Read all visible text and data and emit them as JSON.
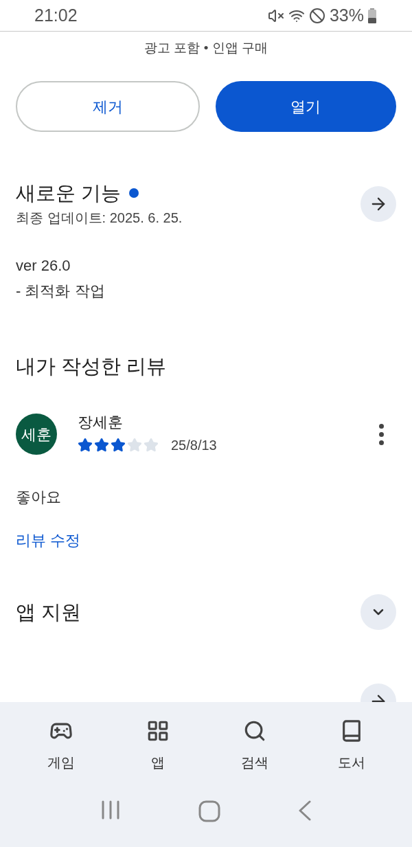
{
  "status_bar": {
    "time": "21:02",
    "battery": "33%"
  },
  "app_meta": "광고 포함 • 인앱 구매",
  "buttons": [
    {
      "label": "제거",
      "kind": "outline"
    },
    {
      "label": "열기",
      "kind": "filled"
    }
  ],
  "whats_new": {
    "title": "새로운 기능",
    "new_dot": true,
    "updated": "최종 업데이트: 2025. 6. 25.",
    "lines": [
      "ver 26.0",
      "- 최적화 작업"
    ]
  },
  "my_review": {
    "title": "내가 작성한 리뷰",
    "avatar": "세훈",
    "author": "장세훈",
    "stars": 3,
    "date": "25/8/13",
    "body": "좋아요",
    "edit_link": "리뷰 수정"
  },
  "sections": [
    {
      "title": "앱 지원",
      "kind": "expand"
    },
    {
      "kind": "arrow"
    }
  ],
  "bottom_nav": [
    {
      "label": "게임",
      "kind": "game"
    },
    {
      "label": "앱",
      "kind": "apps"
    },
    {
      "label": "검색",
      "kind": "search"
    },
    {
      "label": "도서",
      "kind": "book"
    }
  ]
}
